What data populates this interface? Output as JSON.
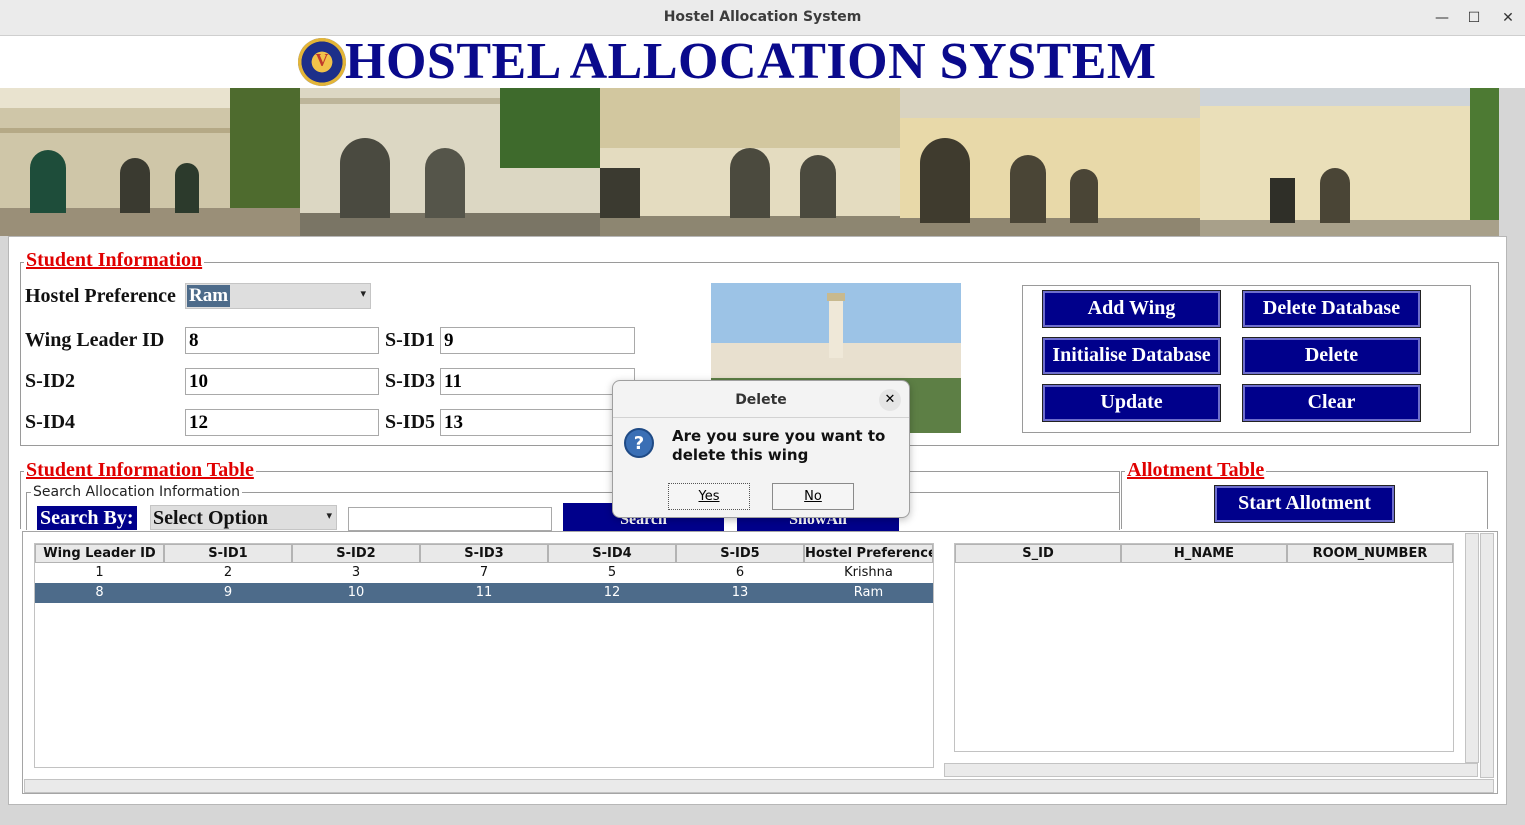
{
  "window": {
    "title": "Hostel Allocation System"
  },
  "header": {
    "app_title": "HOSTEL ALLOCATION SYSTEM"
  },
  "student_info": {
    "section_label": "Student Information",
    "hostel_pref_label": "Hostel Preference",
    "hostel_pref_value": "Ram",
    "wing_leader_label": "Wing Leader ID",
    "wing_leader_value": "8",
    "sid1_label": "S-ID1",
    "sid1_value": "9",
    "sid2_label": "S-ID2",
    "sid2_value": "10",
    "sid3_label": "S-ID3",
    "sid3_value": "11",
    "sid4_label": "S-ID4",
    "sid4_value": "12",
    "sid5_label": "S-ID5",
    "sid5_value": "13"
  },
  "actions": {
    "add_wing": "Add Wing",
    "delete_database": "Delete Database",
    "initialise_database": "Initialise Database",
    "delete": "Delete",
    "update": "Update",
    "clear": "Clear"
  },
  "student_table": {
    "section_label": "Student Information Table",
    "search_group_label": "Search Allocation Information",
    "search_by_label": "Search By:",
    "search_option": "Select Option",
    "search_value": "",
    "search_button": "Search",
    "showall_button": "ShowAll",
    "columns": [
      "Wing Leader ID",
      "S-ID1",
      "S-ID2",
      "S-ID3",
      "S-ID4",
      "S-ID5",
      "Hostel Preference"
    ],
    "rows": [
      [
        "1",
        "2",
        "3",
        "7",
        "5",
        "6",
        "Krishna"
      ],
      [
        "8",
        "9",
        "10",
        "11",
        "12",
        "13",
        "Ram"
      ]
    ]
  },
  "allotment": {
    "section_label": "Allotment Table",
    "start_button": "Start Allotment",
    "columns": [
      "S_ID",
      "H_NAME",
      "ROOM_NUMBER"
    ]
  },
  "dialog": {
    "title": "Delete",
    "message_line1": "Are you sure you want to",
    "message_line2": "delete this wing",
    "yes": "Yes",
    "no": "No",
    "close_symbol": "✕"
  },
  "colors": {
    "accent_navy": "#00008b",
    "label_red": "#e00000",
    "selected_row": "#4d6b8a"
  }
}
